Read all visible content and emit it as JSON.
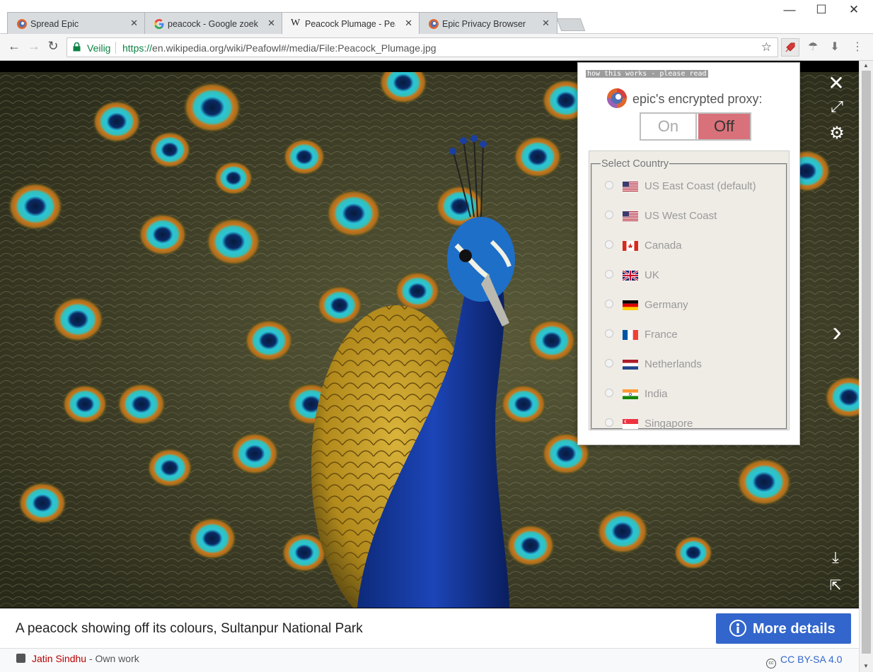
{
  "tabs": [
    {
      "title": "Spread Epic"
    },
    {
      "title": "peacock - Google zoeken"
    },
    {
      "title": "Peacock Plumage - Peafowl"
    },
    {
      "title": "Epic Privacy Browser"
    }
  ],
  "toolbar": {
    "secure_label": "Veilig",
    "url_protocol": "https://",
    "url_rest": "en.wikipedia.org/wiki/Peafowl#/media/File:Peacock_Plumage.jpg"
  },
  "media": {
    "caption": "A peacock showing off its colours, Sultanpur National Park",
    "more_details_label": "More details",
    "author": "Jatin Sindhu",
    "author_suffix": " - Own work",
    "license": "CC BY-SA 4.0"
  },
  "proxy_popup": {
    "how_link": "how this works - please read",
    "title": "epic's encrypted proxy:",
    "on_label": "On",
    "off_label": "Off",
    "state": "Off",
    "select_legend": "Select Country",
    "countries": [
      {
        "name": "US East Coast (default)",
        "flag": "us"
      },
      {
        "name": "US West Coast",
        "flag": "us"
      },
      {
        "name": "Canada",
        "flag": "ca"
      },
      {
        "name": "UK",
        "flag": "uk"
      },
      {
        "name": "Germany",
        "flag": "de"
      },
      {
        "name": "France",
        "flag": "fr"
      },
      {
        "name": "Netherlands",
        "flag": "nl"
      },
      {
        "name": "India",
        "flag": "in"
      },
      {
        "name": "Singapore",
        "flag": "sg"
      }
    ]
  },
  "colors": {
    "accent_blue": "#3366cc",
    "proxy_off": "#d9717a",
    "secure_green": "#0b8043",
    "author_red": "#ba0000"
  }
}
